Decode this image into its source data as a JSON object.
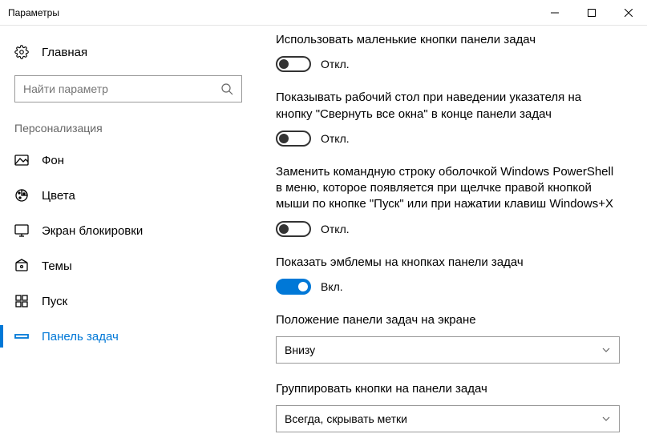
{
  "window": {
    "title": "Параметры"
  },
  "sidebar": {
    "home": "Главная",
    "searchPlaceholder": "Найти параметр",
    "section": "Персонализация",
    "items": [
      {
        "label": "Фон"
      },
      {
        "label": "Цвета"
      },
      {
        "label": "Экран блокировки"
      },
      {
        "label": "Темы"
      },
      {
        "label": "Пуск"
      },
      {
        "label": "Панель задач"
      }
    ],
    "activeIndex": 5
  },
  "content": {
    "settings": [
      {
        "label": "Использовать маленькие кнопки панели задач",
        "type": "toggle",
        "value": false,
        "stateText": "Откл."
      },
      {
        "label": "Показывать рабочий стол при наведении указателя на кнопку \"Свернуть все окна\" в конце панели задач",
        "type": "toggle",
        "value": false,
        "stateText": "Откл."
      },
      {
        "label": "Заменить командную строку оболочкой Windows PowerShell в меню, которое появляется при щелчке правой кнопкой мыши по кнопке \"Пуск\" или при нажатии клавиш Windows+X",
        "type": "toggle",
        "value": false,
        "stateText": "Откл."
      },
      {
        "label": "Показать эмблемы на кнопках панели задач",
        "type": "toggle",
        "value": true,
        "stateText": "Вкл."
      },
      {
        "label": "Положение панели задач на экране",
        "type": "select",
        "value": "Внизу"
      },
      {
        "label": "Группировать кнопки на панели задач",
        "type": "select",
        "value": "Всегда, скрывать метки"
      }
    ]
  }
}
